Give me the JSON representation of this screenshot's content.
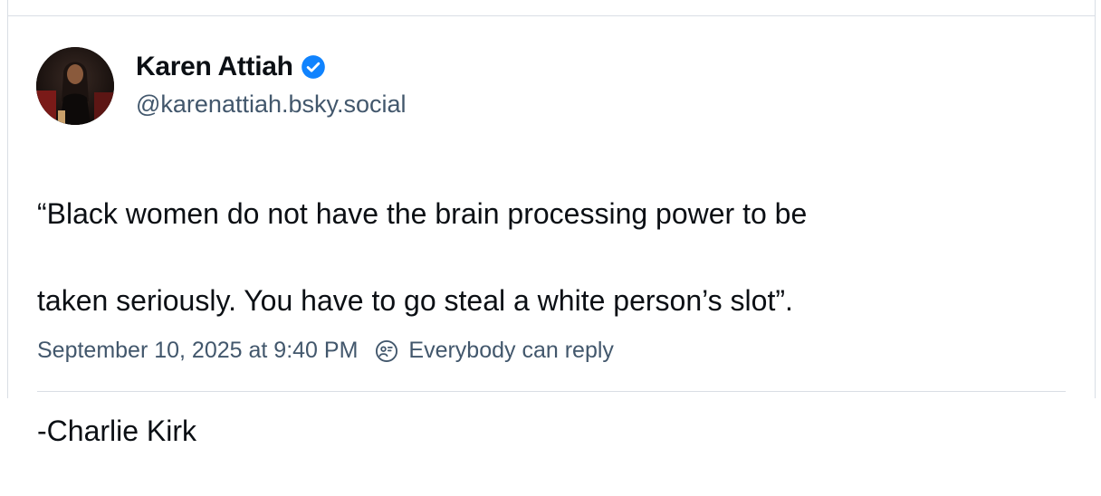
{
  "post": {
    "author": {
      "display_name": "Karen Attiah",
      "handle": "@karenattiah.bsky.social",
      "verified": true
    },
    "text": {
      "line1": "“Black women do not have the brain processing power to be",
      "line2": "taken seriously. You have to go steal a white person’s slot”.",
      "signature": "-Charlie Kirk"
    },
    "timestamp": "September 10, 2025 at 9:40 PM",
    "reply_setting": "Everybody can reply"
  },
  "icons": {
    "verified": "verified-check-icon",
    "reply": "reply-permission-icon"
  },
  "colors": {
    "verified_blue": "#1083fe",
    "secondary_text": "#42576c",
    "border": "#d9dee5"
  }
}
